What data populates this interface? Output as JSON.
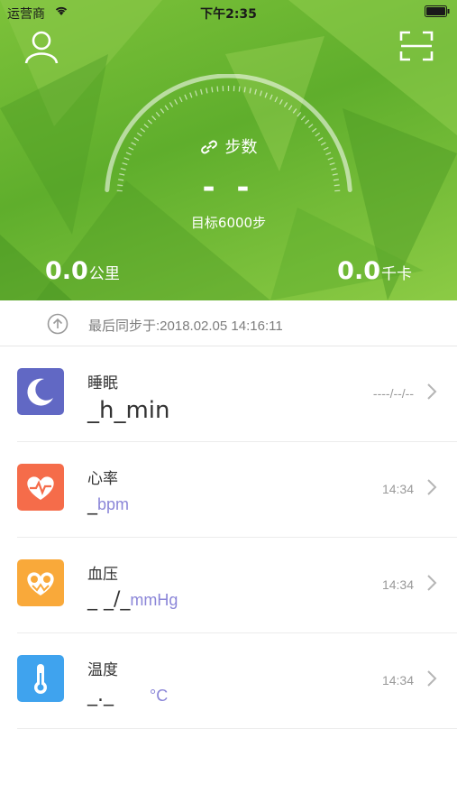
{
  "status_bar": {
    "carrier": "运营商",
    "time": "下午2:35"
  },
  "header": {
    "left_icon": "user-icon",
    "right_icon": "scan-icon"
  },
  "steps": {
    "title": "步数",
    "value": "- -",
    "goal": "目标6000步"
  },
  "stats": {
    "distance": {
      "value": "0.0",
      "unit": "公里"
    },
    "calories": {
      "value": "0.0",
      "unit": "千卡"
    }
  },
  "sync": {
    "text": "最后同步于:2018.02.05 14:16:11",
    "icon": "sync-up-arrow-icon"
  },
  "metrics": [
    {
      "name": "睡眠",
      "value_main": "_h_min",
      "time": "----/--/--",
      "icon": "moon-icon",
      "color": "#6168c4"
    },
    {
      "name": "心率",
      "value_prefix": "_",
      "unit": "bpm",
      "time": "14:34",
      "icon": "heart-pulse-icon",
      "color": "#f56c4a"
    },
    {
      "name": "血压",
      "value_prefix": "_ _/_",
      "unit": "mmHg",
      "time": "14:34",
      "icon": "blood-pressure-heart-icon",
      "color": "#f9a93a"
    },
    {
      "name": "温度",
      "value_prefix": "_._",
      "unit": "°C",
      "time": "14:34",
      "icon": "thermometer-icon",
      "color": "#3fa3ee"
    }
  ],
  "colors": {
    "hero_green": "#6db836",
    "unit_purple": "#8b86d8"
  }
}
